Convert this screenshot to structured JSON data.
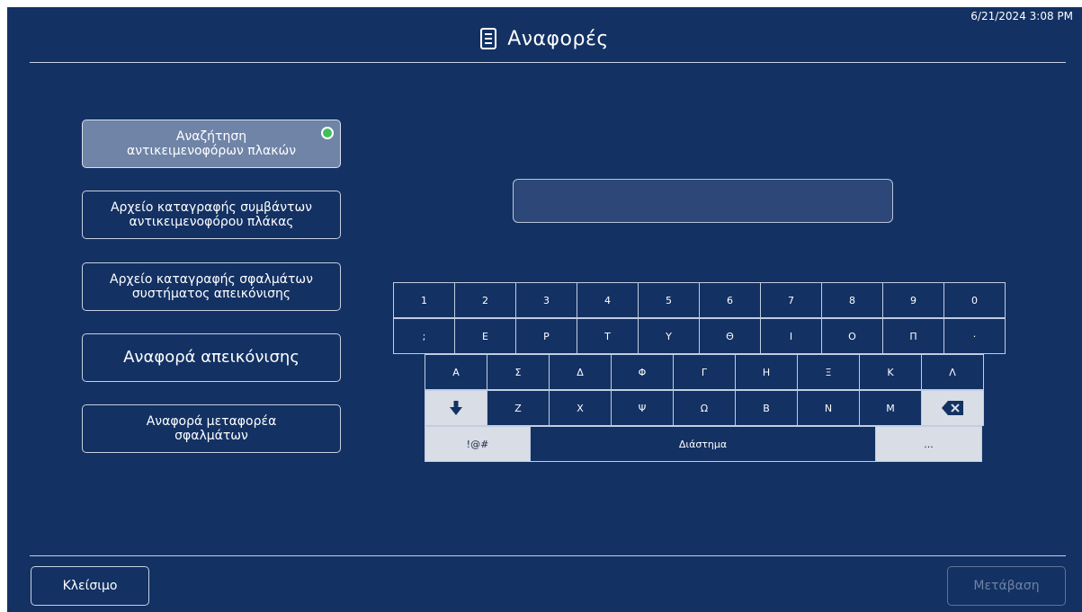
{
  "datetime": "6/21/2024 3:08 PM",
  "header": {
    "title": "Αναφορές",
    "icon": "document-icon"
  },
  "menu": [
    {
      "label": "Αναζήτηση\nαντικειμενοφόρων πλακών",
      "selected": true
    },
    {
      "label": "Αρχείο καταγραφής συμβάντων\nαντικειμενοφόρου πλάκας",
      "selected": false
    },
    {
      "label": "Αρχείο καταγραφής σφαλμάτων\nσυστήματος απεικόνισης",
      "selected": false
    },
    {
      "label": "Αναφορά απεικόνισης",
      "selected": false
    },
    {
      "label": "Αναφορά μεταφορέα\nσφαλμάτων",
      "selected": false
    }
  ],
  "search": {
    "value": ""
  },
  "keyboard": {
    "row1": [
      "1",
      "2",
      "3",
      "4",
      "5",
      "6",
      "7",
      "8",
      "9",
      "0"
    ],
    "row2": [
      ";",
      "Ε",
      "Ρ",
      "Τ",
      "Υ",
      "Θ",
      "Ι",
      "Ο",
      "Π",
      "·"
    ],
    "row3": [
      "Α",
      "Σ",
      "Δ",
      "Φ",
      "Γ",
      "Η",
      "Ξ",
      "Κ",
      "Λ"
    ],
    "row4": [
      "Ζ",
      "Χ",
      "Ψ",
      "Ω",
      "Β",
      "Ν",
      "Μ"
    ],
    "symbols": "!@#",
    "space": "Διάστημα",
    "ellipsis": "...",
    "shift_icon": "arrow-down-icon",
    "backspace_icon": "backspace-icon"
  },
  "footer": {
    "close": "Κλείσιμο",
    "go": "Μετάβαση"
  },
  "colors": {
    "background": "#133163",
    "selected": "#6f84a6",
    "radio": "#3fbf5a"
  }
}
